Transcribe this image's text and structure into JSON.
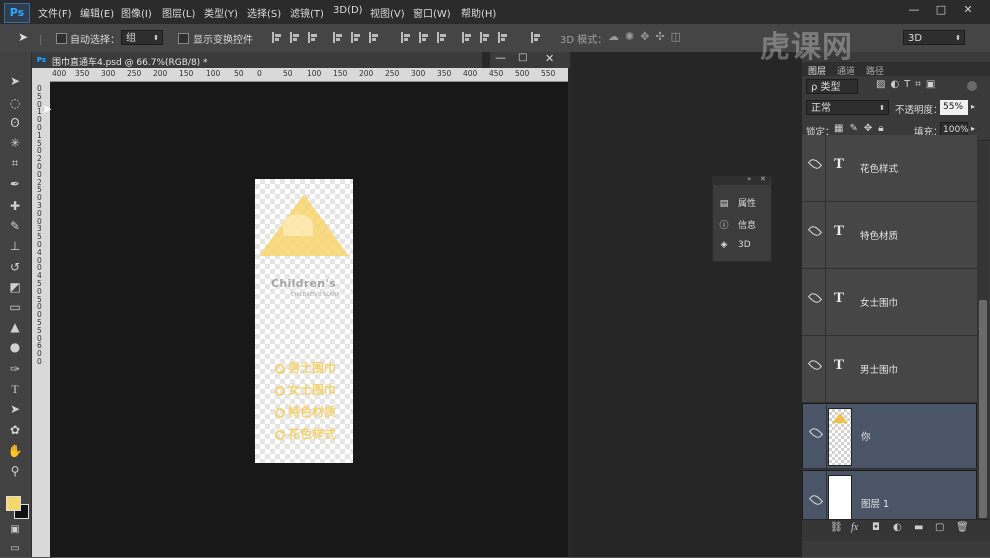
{
  "app": {
    "logo": "Ps",
    "menu": [
      "文件(F)",
      "编辑(E)",
      "图像(I)",
      "图层(L)",
      "类型(Y)",
      "选择(S)",
      "滤镜(T)",
      "3D(D)",
      "视图(V)",
      "窗口(W)",
      "帮助(H)"
    ],
    "window_controls": [
      "—",
      "□",
      "✕"
    ]
  },
  "options_bar": {
    "auto_select_label": "自动选择：",
    "auto_select_value": "组",
    "show_transform_label": "显示变换控件",
    "mode_3d_label": "3D 模式：",
    "workspace_value": "3D"
  },
  "document": {
    "tab_icon": "Ps",
    "title": "围巾直通车4.psd @ 66.7%(RGB/8) *",
    "ruler_top": [
      "400",
      "350",
      "300",
      "250",
      "200",
      "150",
      "100",
      "50",
      "0",
      "50",
      "100",
      "150",
      "200",
      "250",
      "300",
      "350",
      "400",
      "450",
      "500",
      "550"
    ],
    "ruler_left": [
      "0",
      "5",
      "0",
      "1",
      "0",
      "0",
      "1",
      "5",
      "0",
      "2",
      "0",
      "0",
      "2",
      "5",
      "0",
      "3",
      "0",
      "0",
      "3",
      "5",
      "0",
      "4",
      "0",
      "0",
      "4",
      "5",
      "0",
      "5",
      "0",
      "0",
      "5",
      "5",
      "0",
      "6",
      "0",
      "0"
    ],
    "canvas": {
      "brand": "Children's",
      "brand_sub": "CHILDREN'S SCARF",
      "items": [
        "男士围巾",
        "女士围巾",
        "特色材质",
        "花色样式"
      ]
    }
  },
  "mini_panel": {
    "items": [
      {
        "icon": "properties-icon",
        "label": "属性"
      },
      {
        "icon": "info-icon",
        "label": "信息"
      },
      {
        "icon": "3d-icon",
        "label": "3D"
      }
    ]
  },
  "watermark": "虎课网",
  "layers_panel": {
    "tabs": [
      "图层",
      "通道",
      "路径"
    ],
    "filter_label": "ρ 类型",
    "blend_mode": "正常",
    "opacity_label": "不透明度：",
    "opacity_value": "55%",
    "lock_label": "锁定：",
    "fill_label": "填充：",
    "fill_value": "100%",
    "layers": [
      {
        "type": "text",
        "name": "花色样式",
        "selected": false
      },
      {
        "type": "text",
        "name": "特色材质",
        "selected": false
      },
      {
        "type": "text",
        "name": "女士围巾",
        "selected": false
      },
      {
        "type": "text",
        "name": "男士围巾",
        "selected": false
      },
      {
        "type": "image",
        "name": "你",
        "selected": true
      },
      {
        "type": "image",
        "name": "图层 1",
        "selected": true
      }
    ],
    "text_layer_glyph": "T",
    "bottom_icons": [
      "link-icon",
      "fx-icon",
      "mask-icon",
      "adjustment-icon",
      "folder-icon",
      "new-layer-icon",
      "trash-icon"
    ]
  }
}
